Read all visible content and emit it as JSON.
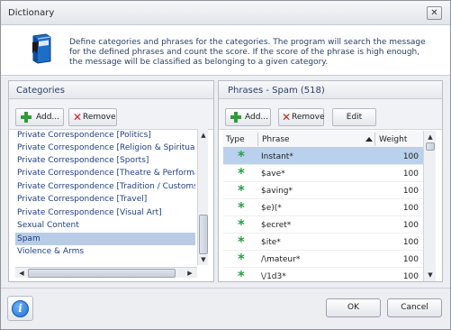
{
  "window": {
    "title": "Dictionary",
    "close_label": "✕"
  },
  "info": {
    "text": "Define categories and phrases for the categories. The program will search the message for the defined phrases and count the score. If the score of the phrase is high enough, the message will be classified as belonging to a given category."
  },
  "categories": {
    "title": "Categories",
    "add_label": "Add...",
    "remove_label": "Remove",
    "items": [
      {
        "label": "Private Correspondence [Politics]",
        "selected": false
      },
      {
        "label": "Private Correspondence [Religion & Spirituality]",
        "selected": false
      },
      {
        "label": "Private Correspondence [Sports]",
        "selected": false
      },
      {
        "label": "Private Correspondence [Theatre & Performance",
        "selected": false
      },
      {
        "label": "Private Correspondence [Tradition / Customs / Fe",
        "selected": false
      },
      {
        "label": "Private Correspondence [Travel]",
        "selected": false
      },
      {
        "label": "Private Correspondence [Visual Art]",
        "selected": false
      },
      {
        "label": "Sexual Content",
        "selected": false
      },
      {
        "label": "Spam",
        "selected": true
      },
      {
        "label": "Violence & Arms",
        "selected": false
      }
    ]
  },
  "phrases": {
    "title": "Phrases - Spam (518)",
    "add_label": "Add...",
    "remove_label": "Remove",
    "edit_label": "Edit",
    "columns": {
      "type": "Type",
      "phrase": "Phrase",
      "weight": "Weight"
    },
    "rows": [
      {
        "type_icon": "asterisk-icon",
        "phrase": "Instant*",
        "weight": "100",
        "selected": true
      },
      {
        "type_icon": "asterisk-icon",
        "phrase": "$ave*",
        "weight": "100",
        "selected": false
      },
      {
        "type_icon": "asterisk-icon",
        "phrase": "$aving*",
        "weight": "100",
        "selected": false
      },
      {
        "type_icon": "asterisk-icon",
        "phrase": "$e)(*",
        "weight": "100",
        "selected": false
      },
      {
        "type_icon": "asterisk-icon",
        "phrase": "$ecret*",
        "weight": "100",
        "selected": false
      },
      {
        "type_icon": "asterisk-icon",
        "phrase": "$ite*",
        "weight": "100",
        "selected": false
      },
      {
        "type_icon": "asterisk-icon",
        "phrase": "/\\mateur*",
        "weight": "100",
        "selected": false
      },
      {
        "type_icon": "asterisk-icon",
        "phrase": "\\/1d3*",
        "weight": "100",
        "selected": false
      }
    ]
  },
  "footer": {
    "ok_label": "OK",
    "cancel_label": "Cancel"
  },
  "colors": {
    "accent": "#2f9c3a",
    "selection": "#b9cce6",
    "remove": "#d02020",
    "info": "#1f6fd1"
  }
}
